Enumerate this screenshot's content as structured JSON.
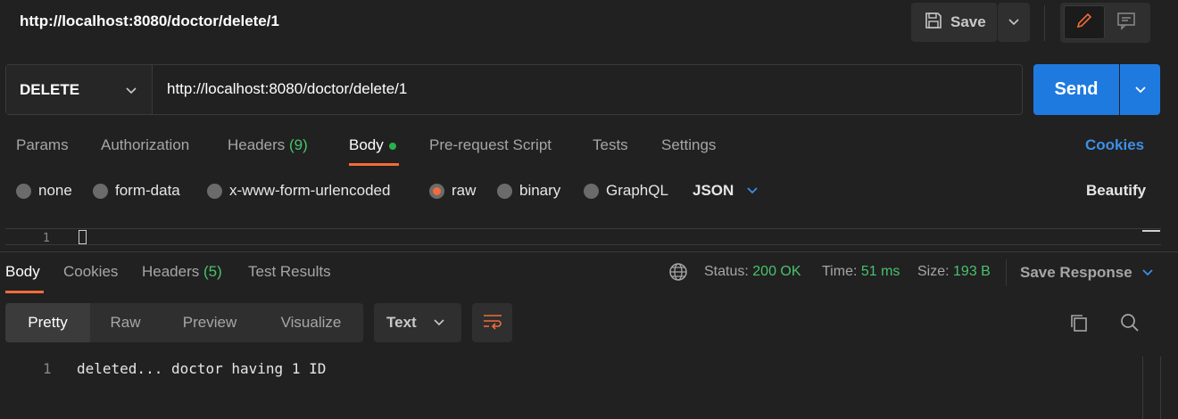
{
  "header": {
    "title": "http://localhost:8080/doctor/delete/1",
    "save_label": "Save"
  },
  "request": {
    "method": "DELETE",
    "url": "http://localhost:8080/doctor/delete/1",
    "send_label": "Send"
  },
  "request_tabs": {
    "params": "Params",
    "authorization": "Authorization",
    "headers": "Headers",
    "headers_count": "(9)",
    "body": "Body",
    "prerequest": "Pre-request Script",
    "tests": "Tests",
    "settings": "Settings",
    "cookies": "Cookies"
  },
  "body_types": {
    "none": "none",
    "form_data": "form-data",
    "urlencoded": "x-www-form-urlencoded",
    "raw": "raw",
    "binary": "binary",
    "graphql": "GraphQL",
    "selected_format": "JSON",
    "beautify": "Beautify"
  },
  "editor": {
    "line_number": "1"
  },
  "response_tabs": {
    "body": "Body",
    "cookies": "Cookies",
    "headers": "Headers",
    "headers_count": "(5)",
    "test_results": "Test Results"
  },
  "response_status": {
    "status_label": "Status:",
    "status_value": "200 OK",
    "time_label": "Time:",
    "time_value": "51 ms",
    "size_label": "Size:",
    "size_value": "193 B",
    "save_response": "Save Response"
  },
  "view_modes": {
    "pretty": "Pretty",
    "raw": "Raw",
    "preview": "Preview",
    "visualize": "Visualize",
    "format": "Text"
  },
  "response_body": {
    "line_number": "1",
    "text": "deleted... doctor having 1 ID"
  },
  "colors": {
    "accent_orange": "#f26b3a",
    "send_blue": "#1f7ae0",
    "link_blue": "#3d8fe8",
    "success_green": "#49c26b"
  }
}
